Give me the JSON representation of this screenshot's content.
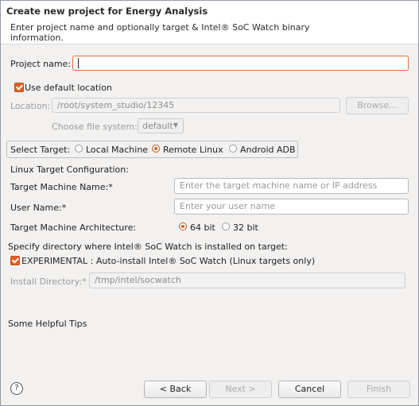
{
  "header": {
    "title": "Create new project for Energy Analysis",
    "description": "Enter project name and optionally target & Intel® SoC Watch binary information."
  },
  "project": {
    "name_label": "Project name:",
    "name_value": "",
    "use_default_location_label": "Use default location",
    "use_default_location_checked": true,
    "location_label": "Location:",
    "location_value": "/root/system_studio/12345",
    "browse_label": "Browse...",
    "file_system_label": "Choose file system:",
    "file_system_value": "default"
  },
  "target": {
    "select_label": "Select Target:",
    "options": [
      "Local Machine",
      "Remote Linux",
      "Android ADB"
    ],
    "selected": "Remote Linux"
  },
  "linux_config": {
    "section_label": "Linux Target Configuration:",
    "machine_name_label": "Target Machine Name:*",
    "machine_name_placeholder": "Enter the target machine name or IP address",
    "user_name_label": "User Name:*",
    "user_name_placeholder": "Enter your user name",
    "arch_label": "Target Machine Architecture:",
    "arch_options": [
      "64 bit",
      "32 bit"
    ],
    "arch_selected": "64 bit"
  },
  "socwatch": {
    "section_label": "Specify directory where Intel® SoC Watch is installed on target:",
    "auto_install_label": "EXPERIMENTAL : Auto-install Intel® SoC Watch (Linux targets only)",
    "auto_install_checked": true,
    "install_dir_label": "Install Directory:*",
    "install_dir_value": "/tmp/intel/socwatch"
  },
  "tips": {
    "label": "Some Helpful Tips"
  },
  "footer": {
    "help_icon": "?",
    "back_label": "< Back",
    "next_label": "Next >",
    "cancel_label": "Cancel",
    "finish_label": "Finish"
  },
  "colors": {
    "accent": "#e2601f",
    "focus_border": "#f06a3b",
    "dialog_bg": "#f2f1f0"
  }
}
